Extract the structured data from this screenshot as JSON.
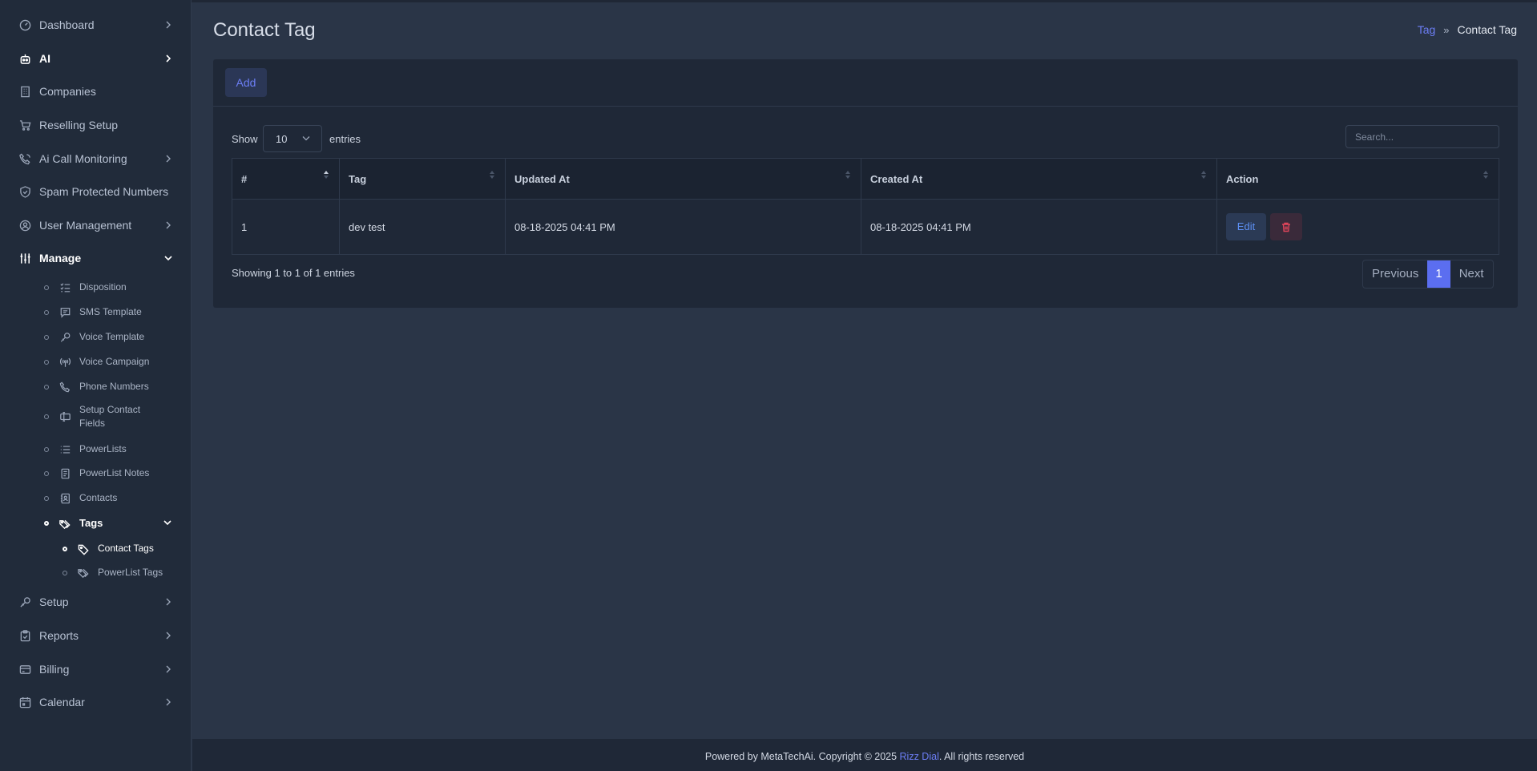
{
  "sidebar": {
    "items": [
      {
        "label": "Dashboard",
        "icon": "dashboard-icon"
      },
      {
        "label": "AI",
        "icon": "robot-icon"
      },
      {
        "label": "Companies",
        "icon": "building-icon"
      },
      {
        "label": "Reselling Setup",
        "icon": "cart-icon"
      },
      {
        "label": "Ai Call Monitoring",
        "icon": "phone-call-icon"
      },
      {
        "label": "Spam Protected Numbers",
        "icon": "shield-check-icon"
      },
      {
        "label": "User Management",
        "icon": "user-circle-icon"
      },
      {
        "label": "Manage",
        "icon": "sliders-icon"
      },
      {
        "label": "Setup",
        "icon": "wrench-icon"
      },
      {
        "label": "Reports",
        "icon": "clipboard-icon"
      },
      {
        "label": "Billing",
        "icon": "credit-card-icon"
      },
      {
        "label": "Calendar",
        "icon": "calendar-icon"
      }
    ],
    "manage_children": [
      {
        "label": "Disposition",
        "icon": "list-check-icon"
      },
      {
        "label": "SMS Template",
        "icon": "message-icon"
      },
      {
        "label": "Voice Template",
        "icon": "microphone-icon"
      },
      {
        "label": "Voice Campaign",
        "icon": "broadcast-icon"
      },
      {
        "label": "Phone Numbers",
        "icon": "phone-icon"
      },
      {
        "label": "Setup Contact Fields",
        "icon": "form-field-icon"
      },
      {
        "label": "PowerLists",
        "icon": "list-icon"
      },
      {
        "label": "PowerList Notes",
        "icon": "notes-icon"
      },
      {
        "label": "Contacts",
        "icon": "address-book-icon"
      },
      {
        "label": "Tags",
        "icon": "tags-icon"
      }
    ],
    "tags_children": [
      {
        "label": "Contact Tags",
        "icon": "tag-icon"
      },
      {
        "label": "PowerList Tags",
        "icon": "tags-icon"
      }
    ]
  },
  "header": {
    "title": "Contact Tag",
    "breadcrumb": {
      "link": "Tag",
      "separator": "»",
      "current": "Contact Tag"
    }
  },
  "toolbar": {
    "add_label": "Add"
  },
  "table_controls": {
    "show_label": "Show",
    "page_length": "10",
    "entries_label": "entries",
    "search_placeholder": "Search..."
  },
  "table": {
    "columns": [
      "#",
      "Tag",
      "Updated At",
      "Created At",
      "Action"
    ],
    "rows": [
      {
        "num": "1",
        "tag": "dev test",
        "updated_at": "08-18-2025 04:41 PM",
        "created_at": "08-18-2025 04:41 PM",
        "edit_label": "Edit"
      }
    ]
  },
  "pagination": {
    "info": "Showing 1 to 1 of 1 entries",
    "previous": "Previous",
    "current_page": "1",
    "next": "Next"
  },
  "footer": {
    "prefix": "Powered by MetaTechAi. Copyright © 2025 ",
    "brand": "Rizz Dial",
    "suffix": ". All rights reserved"
  },
  "colors": {
    "accent": "#5b6ef0",
    "link": "#6c7ef5",
    "danger": "#e0455a",
    "sidebar_bg": "#212b3a",
    "main_bg": "#2a3547"
  }
}
